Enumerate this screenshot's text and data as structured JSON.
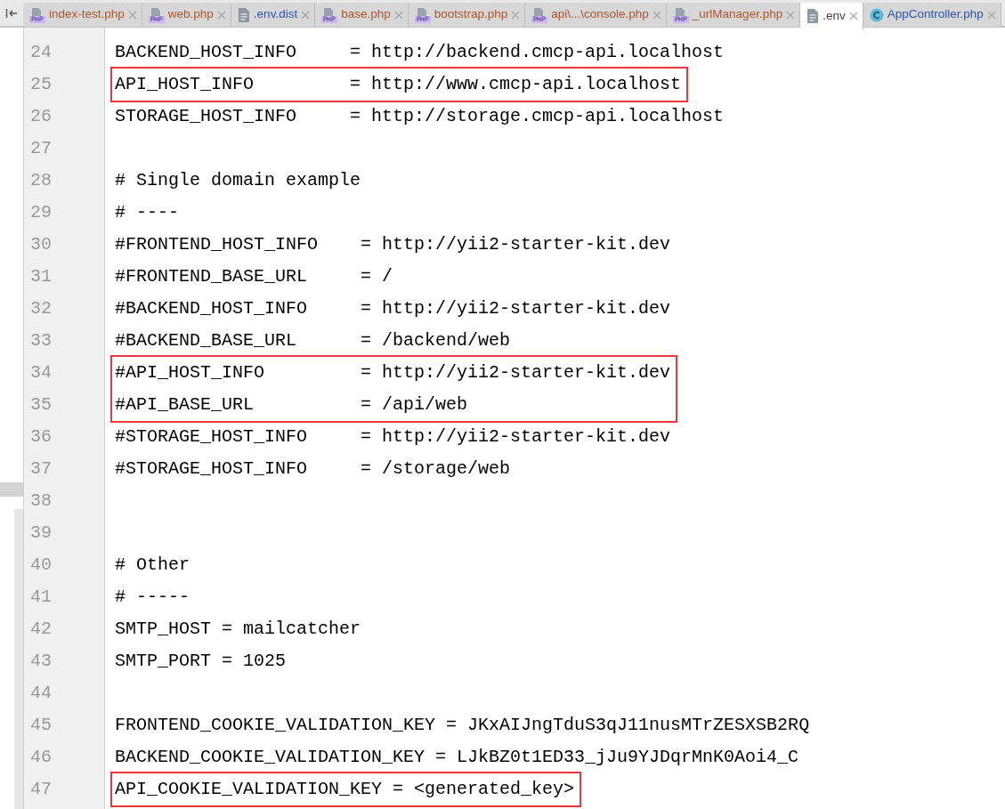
{
  "tabs": [
    {
      "label": "index-test.php",
      "kind": "php",
      "color": "#b5532a",
      "selected": false
    },
    {
      "label": "web.php",
      "kind": "php",
      "color": "#b5532a",
      "selected": false
    },
    {
      "label": ".env.dist",
      "kind": "text",
      "color": "#2a55c0",
      "selected": false
    },
    {
      "label": "base.php",
      "kind": "php",
      "color": "#b5532a",
      "selected": false
    },
    {
      "label": "bootstrap.php",
      "kind": "php",
      "color": "#b5532a",
      "selected": false
    },
    {
      "label": "api\\...\\console.php",
      "kind": "php",
      "color": "#b5532a",
      "selected": false
    },
    {
      "label": "_urlManager.php",
      "kind": "php",
      "color": "#b5532a",
      "selected": false
    },
    {
      "label": ".env",
      "kind": "text",
      "color": "#444444",
      "selected": true
    },
    {
      "label": "AppController.php",
      "kind": "class",
      "color": "#2a55c0",
      "selected": false
    }
  ],
  "lines": [
    {
      "number": "24",
      "text": "BACKEND_HOST_INFO     = http://backend.cmcp-api.localhost",
      "highlight": false
    },
    {
      "number": "25",
      "text": "API_HOST_INFO         = http://www.cmcp-api.localhost",
      "highlight": true
    },
    {
      "number": "26",
      "text": "STORAGE_HOST_INFO     = http://storage.cmcp-api.localhost",
      "highlight": false
    },
    {
      "number": "27",
      "highlight": false
    },
    {
      "number": "28",
      "text": "# Single domain example",
      "highlight": false
    },
    {
      "number": "29",
      "text": "# ----",
      "highlight": false
    },
    {
      "number": "30",
      "text": "#FRONTEND_HOST_INFO    = http://yii2-starter-kit.dev",
      "highlight": false
    },
    {
      "number": "31",
      "text": "#FRONTEND_BASE_URL     = /",
      "highlight": false
    },
    {
      "number": "32",
      "text": "#BACKEND_HOST_INFO     = http://yii2-starter-kit.dev",
      "highlight": false
    },
    {
      "number": "33",
      "text": "#BACKEND_BASE_URL      = /backend/web",
      "highlight": false
    },
    {
      "number": "34",
      "text": "#API_HOST_INFO         = http://yii2-starter-kit.dev",
      "highlight": true
    },
    {
      "number": "35",
      "text": "#API_BASE_URL          = /api/web",
      "highlight": true
    },
    {
      "number": "36",
      "text": "#STORAGE_HOST_INFO     = http://yii2-starter-kit.dev",
      "highlight": false
    },
    {
      "number": "37",
      "text": "#STORAGE_HOST_INFO     = /storage/web",
      "highlight": false
    },
    {
      "number": "38",
      "highlight": false
    },
    {
      "number": "39",
      "highlight": false
    },
    {
      "number": "40",
      "text": "# Other",
      "highlight": false
    },
    {
      "number": "41",
      "text": "# -----",
      "highlight": false
    },
    {
      "number": "42",
      "text": "SMTP_HOST = mailcatcher",
      "highlight": false
    },
    {
      "number": "43",
      "text": "SMTP_PORT = 1025",
      "highlight": false
    },
    {
      "number": "44",
      "highlight": false
    },
    {
      "number": "45",
      "text": "FRONTEND_COOKIE_VALIDATION_KEY = JKxAIJngTduS3qJ11nusMTrZESXSB2RQ",
      "highlight": false
    },
    {
      "number": "46",
      "text": "BACKEND_COOKIE_VALIDATION_KEY = LJkBZ0t1ED33_jJu9YJDqrMnK0Aoi4_C",
      "highlight": false
    },
    {
      "number": "47",
      "text": "API_COOKIE_VALIDATION_KEY = <generated_key>",
      "highlight": true
    }
  ]
}
